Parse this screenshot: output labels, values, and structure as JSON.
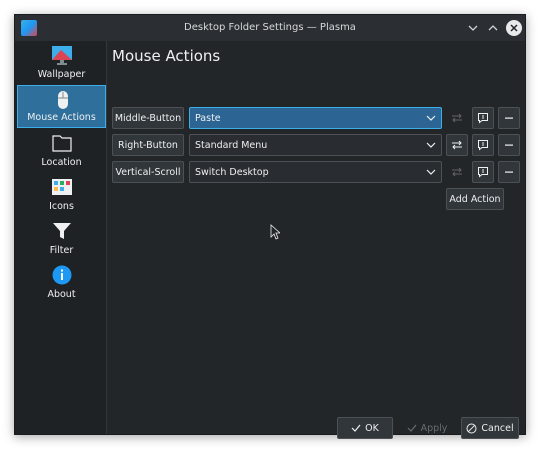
{
  "window": {
    "title": "Desktop Folder Settings — Plasma"
  },
  "sidebar": {
    "items": [
      {
        "label": "Wallpaper",
        "icon": "wallpaper-icon"
      },
      {
        "label": "Mouse Actions",
        "icon": "mouse-icon",
        "selected": true
      },
      {
        "label": "Location",
        "icon": "folder-icon"
      },
      {
        "label": "Icons",
        "icon": "icons-grid-icon"
      },
      {
        "label": "Filter",
        "icon": "filter-icon"
      },
      {
        "label": "About",
        "icon": "info-icon"
      }
    ]
  },
  "main": {
    "title": "Mouse Actions",
    "actions": [
      {
        "trigger": "Middle-Button",
        "action": "Paste",
        "configure_enabled": false
      },
      {
        "trigger": "Right-Button",
        "action": "Standard Menu",
        "configure_enabled": true
      },
      {
        "trigger": "Vertical-Scroll",
        "action": "Switch Desktop",
        "configure_enabled": false
      }
    ],
    "add_action_label": "Add Action"
  },
  "footer": {
    "ok_label": "OK",
    "apply_label": "Apply",
    "cancel_label": "Cancel"
  },
  "colors": {
    "accent": "#3daee9",
    "selected_bg": "#2f6f9b",
    "window_bg": "#232629"
  }
}
